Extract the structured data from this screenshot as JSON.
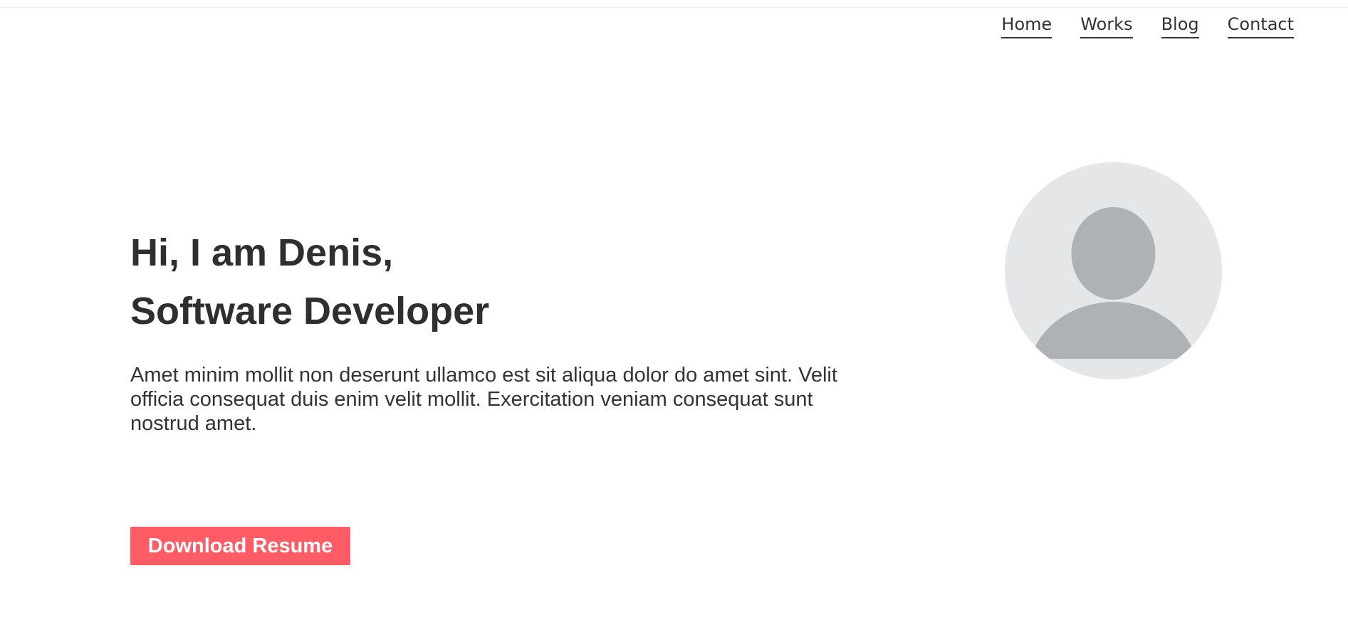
{
  "nav": {
    "items": [
      {
        "label": "Home"
      },
      {
        "label": "Works"
      },
      {
        "label": "Blog"
      },
      {
        "label": "Contact"
      }
    ]
  },
  "hero": {
    "title_line1": "Hi, I am Denis,",
    "title_line2": "Software Developer",
    "description": "Amet minim mollit non deserunt ullamco est sit aliqua dolor do amet sint. Velit officia consequat duis enim velit mollit. Exercitation veniam consequat sunt nostrud amet.",
    "button_label": "Download Resume"
  },
  "avatar": {
    "icon": "user-placeholder-icon"
  },
  "colors": {
    "accent": "#ff5c65",
    "text": "#333333",
    "avatar_bg": "#e4e6e8",
    "avatar_fg": "#aeb2b5"
  }
}
